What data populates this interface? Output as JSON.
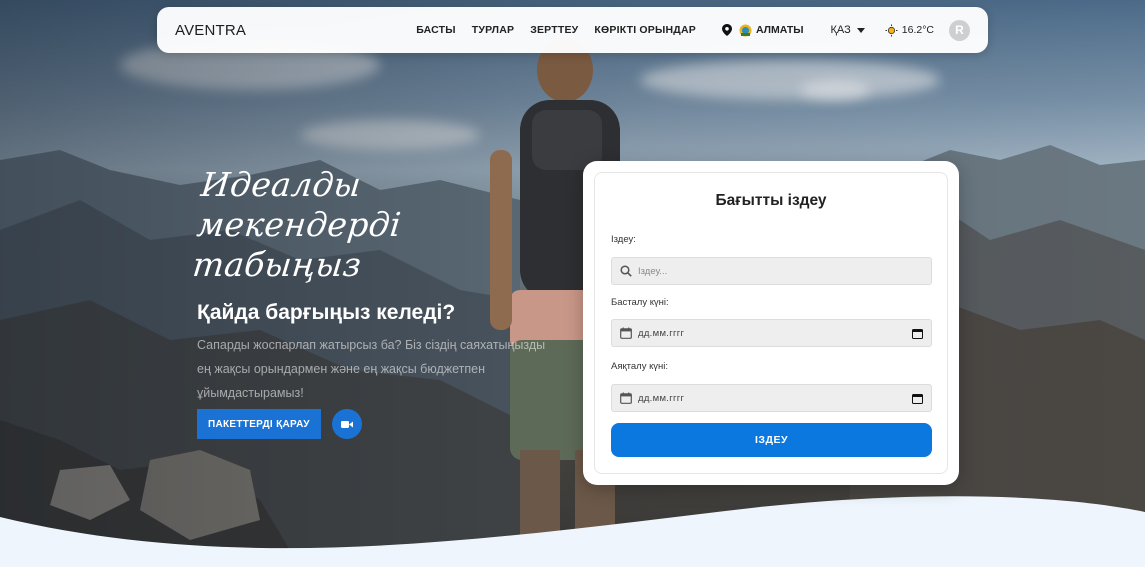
{
  "navbar": {
    "logo": "AVENTRA",
    "links": [
      "БАСТЫ",
      "ТУРЛАР",
      "ЗЕРТТЕУ",
      "КӨРІКТІ ОРЫНДАР"
    ],
    "location": "АЛМАТЫ",
    "language": "ҚАЗ",
    "weather": "16.2°C",
    "avatar_initial": "R"
  },
  "hero": {
    "script_title_line1": "Идеалды мекендерді",
    "script_title_line2": "табыңыз",
    "headline": "Қайда барғыңыз келеді?",
    "subtitle": "Сапарды жоспарлап жатырсыз ба? Біз сіздің саяхатыңызды ең жақсы орындармен және ең жақсы бюджетпен ұйымдастырамыз!",
    "cta_label": "ПАКЕТТЕРДІ ҚАРАУ"
  },
  "search_card": {
    "title": "Бағытты іздеу",
    "search_label": "Іздеу:",
    "search_placeholder": "Іздеу...",
    "start_label": "Басталу күні:",
    "start_value": "дд.мм.гггг",
    "end_label": "Аяқталу күні:",
    "end_value": "дд.мм.гггг",
    "submit_label": "ІЗДЕУ"
  },
  "colors": {
    "accent": "#1a73d4",
    "search_button": "#0b78df",
    "wave": "#eef5fd"
  },
  "icons": {
    "location": "location-pin-icon",
    "city_badge": "kz-emblem-icon",
    "language_caret": "caret-down-icon",
    "weather": "sun-icon",
    "video": "video-camera-icon",
    "search": "magnifier-icon",
    "calendar": "calendar-icon"
  }
}
